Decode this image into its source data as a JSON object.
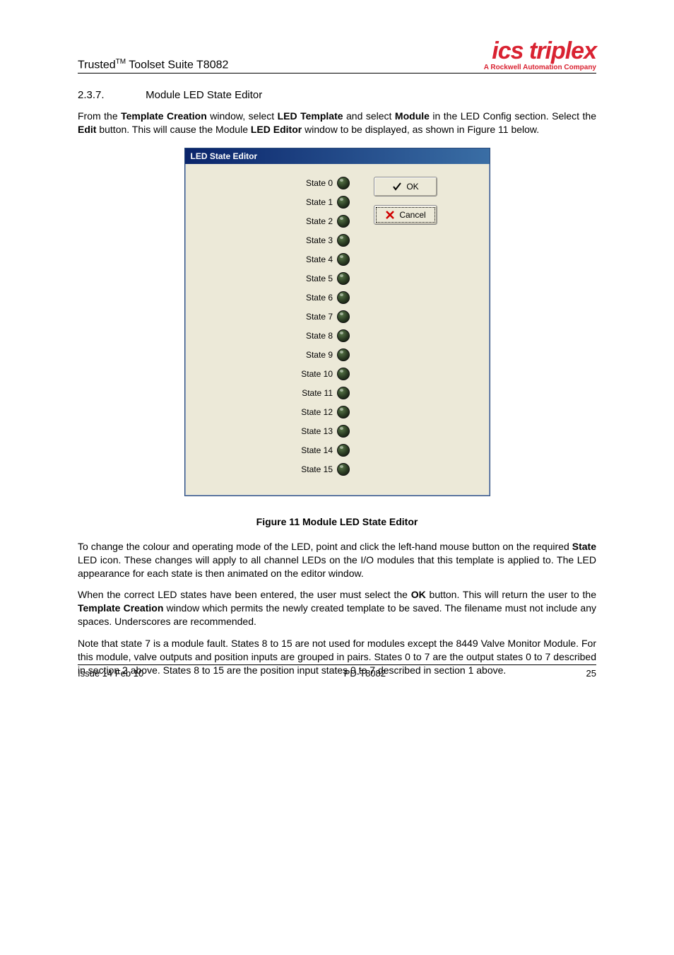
{
  "header": {
    "title_prefix": "Trusted",
    "title_tm": "TM",
    "title_suffix": " Toolset Suite T8082",
    "logo_main": "ics triplex",
    "logo_sub_bold": "A Rockwell Automation",
    "logo_sub_rest": " Company"
  },
  "section": {
    "number": "2.3.7.",
    "title": "Module LED State Editor"
  },
  "paragraphs": {
    "p1_a": "From the ",
    "p1_b": "Template Creation",
    "p1_c": " window, select ",
    "p1_d": "LED Template",
    "p1_e": " and select ",
    "p1_f": "Module",
    "p1_g": " in the LED Config section. Select the ",
    "p1_h": "Edit",
    "p1_i": " button.  This will cause the Module ",
    "p1_j": "LED Editor",
    "p1_k": " window to be displayed, as shown in Figure 11 below.",
    "p2_a": "To change the colour and operating mode of the LED, point and click the left-hand mouse button on the required ",
    "p2_b": "State",
    "p2_c": " LED icon.  These changes will apply to all channel LEDs on the I/O modules that this template is applied to. The LED appearance for each state is then animated on the editor window.",
    "p3_a": "When the correct LED states have been entered, the user must select the ",
    "p3_b": "OK",
    "p3_c": " button.  This will return the user to the ",
    "p3_d": "Template Creation",
    "p3_e": " window which permits the newly created template to be saved. The filename must not include any spaces. Underscores are recommended.",
    "p4": "Note that state 7 is a module fault. States 8 to 15 are not used for modules except the 8449 Valve Monitor Module. For this module, valve outputs and position inputs are grouped in pairs. States 0 to 7 are the output states 0 to 7 described in section 2 above. States 8 to 15 are the position input states 0 to 7 described in section 1 above."
  },
  "dialog": {
    "title": "LED State Editor",
    "ok_label": "OK",
    "cancel_label": "Cancel",
    "states": [
      {
        "label": "State 0"
      },
      {
        "label": "State 1"
      },
      {
        "label": "State 2"
      },
      {
        "label": "State 3"
      },
      {
        "label": "State 4"
      },
      {
        "label": "State 5"
      },
      {
        "label": "State 6"
      },
      {
        "label": "State 7"
      },
      {
        "label": "State 8"
      },
      {
        "label": "State 9"
      },
      {
        "label": "State 10"
      },
      {
        "label": "State 11"
      },
      {
        "label": "State 12"
      },
      {
        "label": "State 13"
      },
      {
        "label": "State 14"
      },
      {
        "label": "State 15"
      }
    ]
  },
  "figure_caption": "Figure 11 Module LED State Editor",
  "footer": {
    "left": "Issue 14 Feb 10",
    "center": "PD-T8082",
    "right": "25"
  }
}
